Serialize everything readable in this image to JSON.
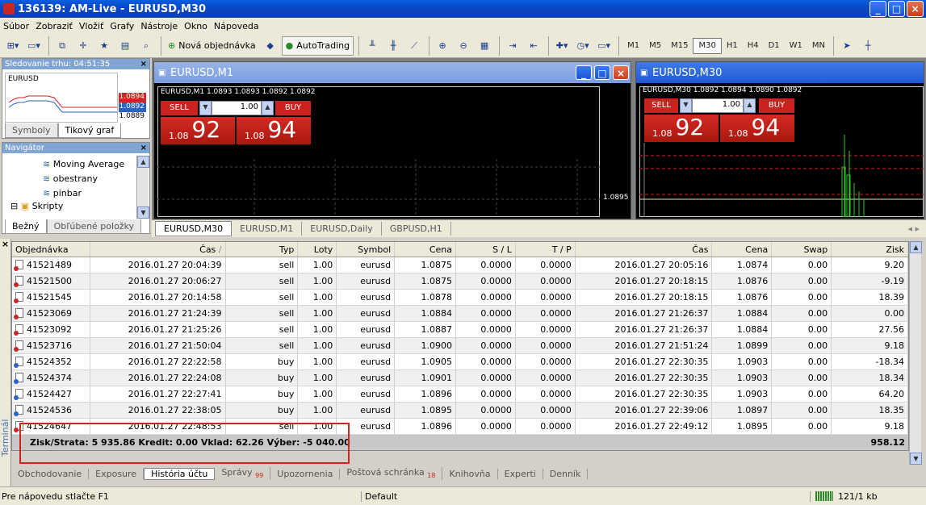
{
  "window": {
    "title": "136139: AM-Live - EURUSD,M30"
  },
  "menu": [
    "Súbor",
    "Zobraziť",
    "Vložiť",
    "Grafy",
    "Nástroje",
    "Okno",
    "Nápoveda"
  ],
  "toolbar": {
    "new_order": "Nová objednávka",
    "autotrading": "AutoTrading",
    "timeframes": [
      "M1",
      "M5",
      "M15",
      "M30",
      "H1",
      "H4",
      "D1",
      "W1",
      "MN"
    ],
    "active_timeframe": "M30"
  },
  "market_watch": {
    "title": "Sledovanie trhu: 04:51:35",
    "symbol": "EURUSD",
    "prices": [
      "1.0894",
      "1.0892",
      "1.0889"
    ],
    "tabs": [
      "Symboly",
      "Tikový graf"
    ]
  },
  "navigator": {
    "title": "Navigátor",
    "items": [
      "Moving Average",
      "obestrany",
      "pinbar",
      "Skripty"
    ],
    "tabs": [
      "Bežný",
      "Obľúbené položky"
    ]
  },
  "charts": [
    {
      "title": "EURUSD,M1",
      "info": "EURUSD,M1  1.0893 1.0893 1.0892 1.0892",
      "sell": "SELL",
      "buy": "BUY",
      "qty": "1.00",
      "sell_small": "1.08",
      "sell_big": "92",
      "buy_small": "1.08",
      "buy_big": "94",
      "price_label": "1.0895"
    },
    {
      "title": "EURUSD,M30",
      "info": "EURUSD,M30  1.0892 1.0894 1.0890 1.0892",
      "sell": "SELL",
      "buy": "BUY",
      "qty": "1.00",
      "sell_small": "1.08",
      "sell_big": "92",
      "buy_small": "1.08",
      "buy_big": "94"
    }
  ],
  "chart_tabs": [
    "EURUSD,M30",
    "EURUSD,M1",
    "EURUSD,Daily",
    "GBPUSD,H1"
  ],
  "terminal": {
    "side_label": "Terminál",
    "headers": [
      "Objednávka",
      "Čas",
      "Typ",
      "Loty",
      "Symbol",
      "Cena",
      "S / L",
      "T / P",
      "Čas",
      "Cena",
      "Swap",
      "Zisk"
    ],
    "rows": [
      [
        "41521489",
        "2016.01.27 20:04:39",
        "sell",
        "1.00",
        "eurusd",
        "1.0875",
        "0.0000",
        "0.0000",
        "2016.01.27 20:05:16",
        "1.0874",
        "0.00",
        "9.20"
      ],
      [
        "41521500",
        "2016.01.27 20:06:27",
        "sell",
        "1.00",
        "eurusd",
        "1.0875",
        "0.0000",
        "0.0000",
        "2016.01.27 20:18:15",
        "1.0876",
        "0.00",
        "-9.19"
      ],
      [
        "41521545",
        "2016.01.27 20:14:58",
        "sell",
        "1.00",
        "eurusd",
        "1.0878",
        "0.0000",
        "0.0000",
        "2016.01.27 20:18:15",
        "1.0876",
        "0.00",
        "18.39"
      ],
      [
        "41523069",
        "2016.01.27 21:24:39",
        "sell",
        "1.00",
        "eurusd",
        "1.0884",
        "0.0000",
        "0.0000",
        "2016.01.27 21:26:37",
        "1.0884",
        "0.00",
        "0.00"
      ],
      [
        "41523092",
        "2016.01.27 21:25:26",
        "sell",
        "1.00",
        "eurusd",
        "1.0887",
        "0.0000",
        "0.0000",
        "2016.01.27 21:26:37",
        "1.0884",
        "0.00",
        "27.56"
      ],
      [
        "41523716",
        "2016.01.27 21:50:04",
        "sell",
        "1.00",
        "eurusd",
        "1.0900",
        "0.0000",
        "0.0000",
        "2016.01.27 21:51:24",
        "1.0899",
        "0.00",
        "9.18"
      ],
      [
        "41524352",
        "2016.01.27 22:22:58",
        "buy",
        "1.00",
        "eurusd",
        "1.0905",
        "0.0000",
        "0.0000",
        "2016.01.27 22:30:35",
        "1.0903",
        "0.00",
        "-18.34"
      ],
      [
        "41524374",
        "2016.01.27 22:24:08",
        "buy",
        "1.00",
        "eurusd",
        "1.0901",
        "0.0000",
        "0.0000",
        "2016.01.27 22:30:35",
        "1.0903",
        "0.00",
        "18.34"
      ],
      [
        "41524427",
        "2016.01.27 22:27:41",
        "buy",
        "1.00",
        "eurusd",
        "1.0896",
        "0.0000",
        "0.0000",
        "2016.01.27 22:30:35",
        "1.0903",
        "0.00",
        "64.20"
      ],
      [
        "41524536",
        "2016.01.27 22:38:05",
        "buy",
        "1.00",
        "eurusd",
        "1.0895",
        "0.0000",
        "0.0000",
        "2016.01.27 22:39:06",
        "1.0897",
        "0.00",
        "18.35"
      ],
      [
        "41524647",
        "2016.01.27 22:48:53",
        "sell",
        "1.00",
        "eurusd",
        "1.0896",
        "0.0000",
        "0.0000",
        "2016.01.27 22:49:12",
        "1.0895",
        "0.00",
        "9.18"
      ]
    ],
    "summary": "Zisk/Strata: 5 935.86  Kredit: 0.00  Vklad: 62.26  Výber: -5 040.00",
    "summary_total": "958.12",
    "tabs": [
      "Obchodovanie",
      "Exposure",
      "História účtu",
      "Správy",
      "Upozornenia",
      "Poštová schránka",
      "Knihovňa",
      "Experti",
      "Denník"
    ],
    "active_tab": "História účtu",
    "tab_badges": {
      "Správy": "99",
      "Poštová schránka": "18"
    }
  },
  "status": {
    "help": "Pre nápovedu stlačte F1",
    "profile": "Default",
    "traffic": "121/1 kb"
  },
  "colors": {
    "highlight_box": "#d32222",
    "sell_red": "#c9221f",
    "title_blue": "#0a5fe0"
  }
}
